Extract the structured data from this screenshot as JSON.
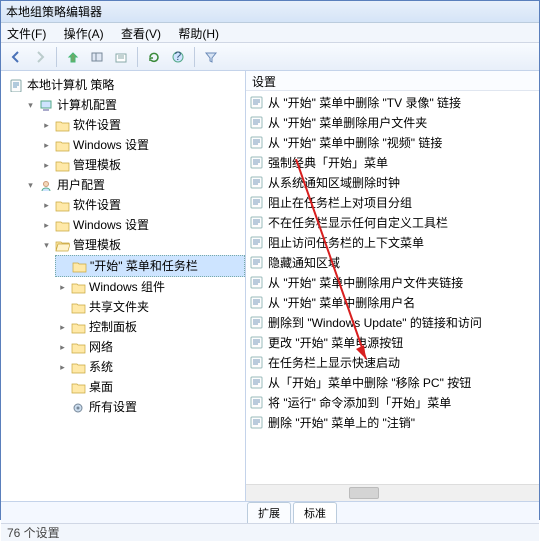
{
  "window": {
    "title": "本地组策略编辑器"
  },
  "menu": {
    "file": "文件(F)",
    "action": "操作(A)",
    "view": "查看(V)",
    "help": "帮助(H)"
  },
  "tree": {
    "root": "本地计算机 策略",
    "computer": "计算机配置",
    "user": "用户配置",
    "software": "软件设置",
    "windows_settings": "Windows 设置",
    "admin_templates": "管理模板",
    "start_taskbar": "\"开始\" 菜单和任务栏",
    "win_components": "Windows 组件",
    "shared_folders": "共享文件夹",
    "control_panel": "控制面板",
    "network": "网络",
    "system": "系统",
    "desktop": "桌面",
    "all_settings": "所有设置"
  },
  "right": {
    "header": "设置",
    "items": [
      "从 \"开始\" 菜单中删除 \"TV 录像\" 链接",
      "从 \"开始\" 菜单删除用户文件夹",
      "从 \"开始\" 菜单中删除 \"视频\" 链接",
      "强制经典「开始」菜单",
      "从系统通知区域删除时钟",
      "阻止在任务栏上对项目分组",
      "不在任务栏显示任何自定义工具栏",
      "阻止访问任务栏的上下文菜单",
      "隐藏通知区域",
      "从 \"开始\" 菜单中删除用户文件夹链接",
      "从 \"开始\" 菜单中删除用户名",
      "删除到 \"Windows Update\" 的链接和访问",
      "更改 \"开始\" 菜单电源按钮",
      "在任务栏上显示快速启动",
      "从「开始」菜单中删除 \"移除 PC\" 按钮",
      "将 \"运行\" 命令添加到「开始」菜单",
      "删除 \"开始\" 菜单上的 \"注销\""
    ]
  },
  "tabs": {
    "extended": "扩展",
    "standard": "标准"
  },
  "status": {
    "text": "76 个设置"
  }
}
